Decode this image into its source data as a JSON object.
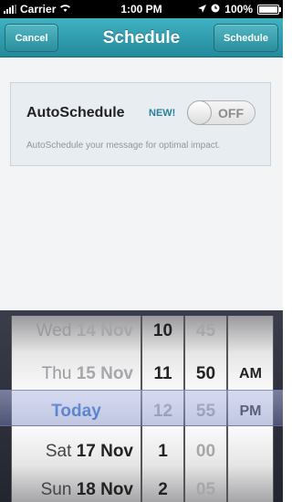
{
  "status_bar": {
    "carrier": "Carrier",
    "time": "1:00 PM",
    "battery": "100%"
  },
  "nav": {
    "cancel_label": "Cancel",
    "title": "Schedule",
    "schedule_label": "Schedule"
  },
  "autoschedule": {
    "title": "AutoSchedule",
    "badge": "NEW!",
    "toggle_state": "OFF",
    "description": "AutoSchedule your message for optimal impact."
  },
  "picker": {
    "dates": [
      {
        "day": "Wed",
        "date": "14 Nov"
      },
      {
        "day": "Thu",
        "date": "15 Nov"
      },
      {
        "today": "Today"
      },
      {
        "day": "Sat",
        "date": "17 Nov"
      },
      {
        "day": "Sun",
        "date": "18 Nov"
      }
    ],
    "hours": [
      "10",
      "11",
      "12",
      "1",
      "2"
    ],
    "minutes": [
      "45",
      "50",
      "55",
      "00",
      "05"
    ],
    "ampm": [
      "AM",
      "PM"
    ]
  },
  "colors": {
    "nav_bar": "#2a95a6",
    "picker_selected_text": "#2a6fd1",
    "badge": "#2a7f9a"
  }
}
